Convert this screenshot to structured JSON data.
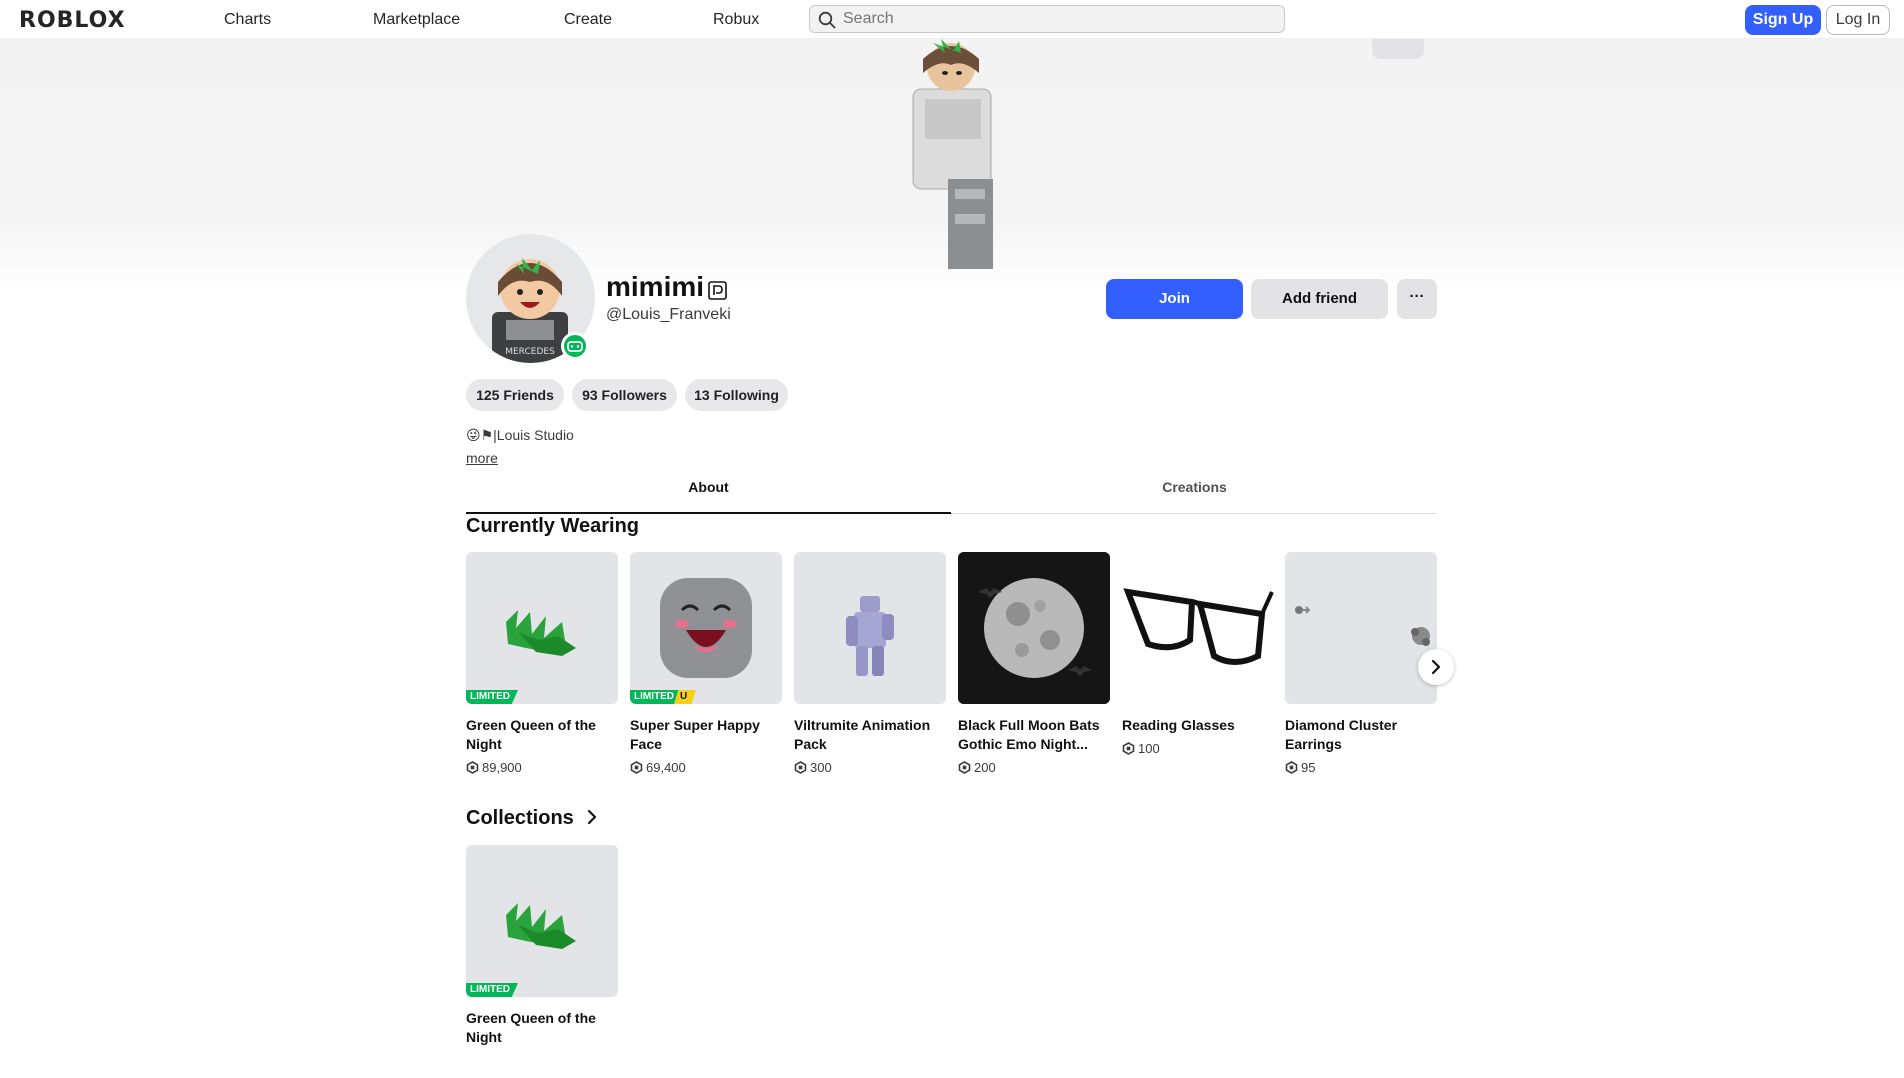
{
  "topbar": {
    "logo": "ROBLOX",
    "nav": [
      "Charts",
      "Marketplace",
      "Create",
      "Robux"
    ],
    "search_placeholder": "Search",
    "signup": "Sign Up",
    "login": "Log In"
  },
  "profile": {
    "display_name": "mimimi",
    "username": "@Louis_Franveki",
    "join": "Join",
    "add_friend": "Add friend",
    "more": "···",
    "friends": "125 Friends",
    "followers": "93 Followers",
    "following": "13 Following",
    "bio": "😜⚑|Louis Studio",
    "bio_more": "more"
  },
  "tabs": [
    "About",
    "Creations"
  ],
  "currently_wearing": {
    "title": "Currently Wearing",
    "items": [
      {
        "name": "Green Queen of the Night",
        "price": "89,900",
        "tag": "LIMITED"
      },
      {
        "name": "Super Super Happy Face",
        "price": "69,400",
        "tag": "LIMITED",
        "tag2": "U"
      },
      {
        "name": "Viltrumite Animation Pack",
        "price": "300"
      },
      {
        "name": "Black Full Moon Bats Gothic Emo Night...",
        "price": "200"
      },
      {
        "name": "Reading Glasses",
        "price": "100"
      },
      {
        "name": "Diamond Cluster Earrings",
        "price": "95"
      }
    ]
  },
  "collections": {
    "title": "Collections",
    "items": [
      {
        "name": "Green Queen of the Night",
        "tag": "LIMITED"
      }
    ]
  },
  "colors": {
    "primary_blue": "#335fff",
    "limited_green": "#02b757",
    "ugc_yellow": "#f5d016"
  }
}
